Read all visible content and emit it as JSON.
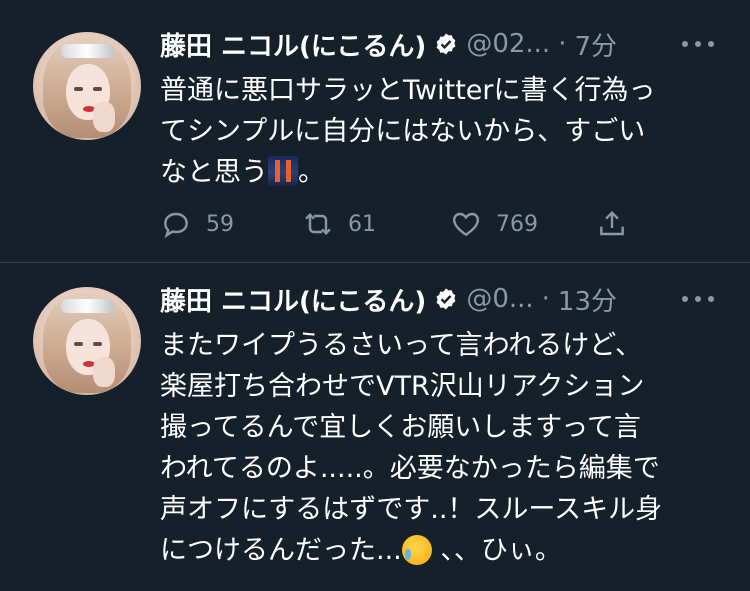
{
  "tweets": [
    {
      "display_name": "藤田 ニコル(にこるん)",
      "handle": "@02...",
      "time": "7分",
      "lines": [
        "普通に悪口サラッとTwitterに書く行為っ",
        "てシンプルに自分にはないから、すごい",
        "なと思う",
        "。"
      ],
      "emoji": "bridge-at-night",
      "reply_count": "59",
      "retweet_count": "61",
      "like_count": "769"
    },
    {
      "display_name": "藤田 ニコル(にこるん)",
      "handle": "@0...",
      "time": "13分",
      "lines": [
        "またワイプうるさいって言われるけど、",
        "楽屋打ち合わせでVTR沢山リアクション",
        "撮ってるんで宜しくお願いしますって言",
        "われてるのよ.....。必要なかったら編集で",
        "声オフにするはずです..！スルースキル身",
        "につけるんだった...",
        "、、ひぃ。"
      ],
      "emoji": "crying-face"
    }
  ],
  "colors": {
    "background": "#15202b",
    "text": "#ffffff",
    "secondary": "#8899a6",
    "divider": "#38444d"
  },
  "icons": [
    "verified-icon",
    "more-icon",
    "reply-icon",
    "retweet-icon",
    "like-icon",
    "share-icon"
  ]
}
